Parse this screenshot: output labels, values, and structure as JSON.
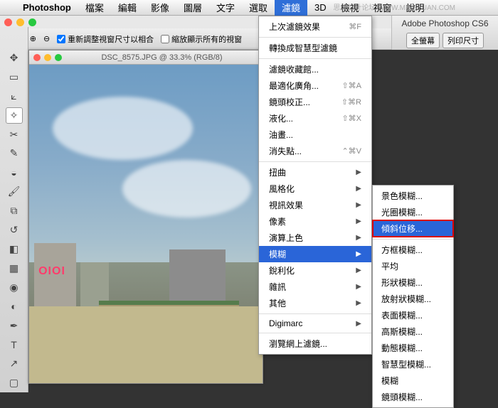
{
  "menubar": {
    "app": "Photoshop",
    "items": [
      "檔案",
      "編輯",
      "影像",
      "圖層",
      "文字",
      "選取",
      "濾鏡",
      "3D",
      "檢視",
      "視窗",
      "說明"
    ],
    "active_index": 6
  },
  "brand": "Adobe Photoshop CS6",
  "right_buttons": {
    "fullscreen": "全螢幕",
    "printsize": "列印尺寸"
  },
  "options": {
    "chk1": "重新調整視窗尺寸以相合",
    "chk2": "縮放顯示所有的視窗"
  },
  "document": {
    "title": "DSC_8575.JPG @ 33.3% (RGB/8)"
  },
  "sign_text": "OIOI",
  "filter_menu": {
    "last": "上次濾鏡效果",
    "last_sc": "⌘F",
    "smart": "轉換成智慧型濾鏡",
    "gallery": "濾鏡收藏館...",
    "wideangle": "最適化廣角...",
    "wideangle_sc": "⇧⌘A",
    "lens": "鏡頭校正...",
    "lens_sc": "⇧⌘R",
    "liquify": "液化...",
    "liquify_sc": "⇧⌘X",
    "oilpaint": "油畫...",
    "vanish": "消失點...",
    "vanish_sc": "⌃⌘V",
    "distort": "扭曲",
    "stylize": "風格化",
    "video": "視訊效果",
    "pixelate": "像素",
    "render": "演算上色",
    "blur": "模糊",
    "sharpen": "銳利化",
    "noise": "雜訊",
    "other": "其他",
    "digimarc": "Digimarc",
    "browse": "瀏覽網上濾鏡..."
  },
  "blur_submenu": {
    "field": "景色模糊...",
    "iris": "光圈模糊...",
    "tiltshift": "傾斜位移...",
    "box": "方框模糊...",
    "average": "平均",
    "shape": "形狀模糊...",
    "radial": "放射狀模糊...",
    "surface": "表面模糊...",
    "gaussian": "高斯模糊...",
    "motion": "動態模糊...",
    "smart": "智慧型模糊...",
    "blur": "模糊",
    "lens": "鏡頭模糊..."
  },
  "watermark": "思缘设计论坛  WWW.MISSYUAN.COM"
}
